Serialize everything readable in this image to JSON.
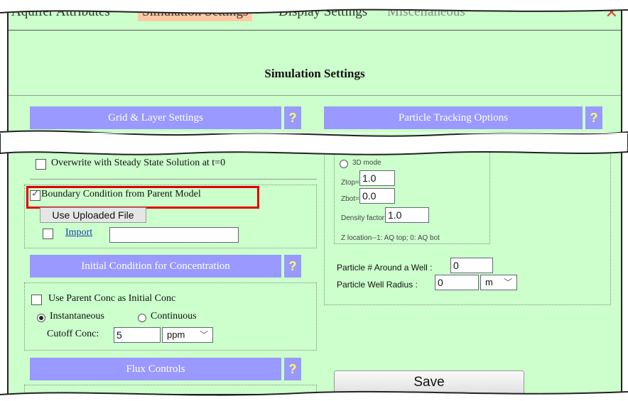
{
  "tabs": [
    {
      "label": "Aquifer Attributes"
    },
    {
      "label": "Simulation Settings"
    },
    {
      "label": "Display Settings"
    },
    {
      "label": "Miscellaneous"
    }
  ],
  "page_title": "Simulation Settings",
  "grid_header": {
    "label": "Grid & Layer Settings",
    "help": "?"
  },
  "particle_header": {
    "label": "Particle Tracking Options",
    "help": "?"
  },
  "overwrite": {
    "label": "Overwrite with Steady State Solution at t=0",
    "checked": false
  },
  "boundary": {
    "label": "Boundary Condition from Parent Model",
    "checked": true
  },
  "use_uploaded_button": "Use Uploaded File",
  "import": {
    "label": "Import",
    "value": ""
  },
  "initial_header": {
    "label": "Initial Condition for Concentration",
    "help": "?"
  },
  "parent_conc": {
    "label": "Use Parent Conc as Initial Conc",
    "checked": false
  },
  "instantaneous": {
    "label": "Instantaneous",
    "selected": true
  },
  "continuous": {
    "label": "Continuous",
    "selected": false
  },
  "cutoff": {
    "label": "Cutoff Conc:",
    "value": "5",
    "unit": "ppm"
  },
  "flux_header": {
    "label": "Flux Controls",
    "help": "?"
  },
  "particle": {
    "partial_label": "3D mode",
    "ztop_label": "Ztop=",
    "ztop_value": "1.0",
    "zbot_label": "Zbot=",
    "zbot_value": "0.0",
    "density_label": "Density factor=",
    "density_value": "1.0",
    "zlocation_note": "Z location--1: AQ top; 0: AQ bot",
    "around_well_label": "Particle # Around a Well :",
    "around_well_value": "0",
    "well_radius_label": "Particle Well Radius :",
    "well_radius_value": "0",
    "well_radius_unit": "m"
  },
  "save_button": "Save",
  "colors": {
    "background": "#ccffcc",
    "header": "#9999ff",
    "active_tab": "#ffc9a3",
    "highlight": "#e00000"
  }
}
